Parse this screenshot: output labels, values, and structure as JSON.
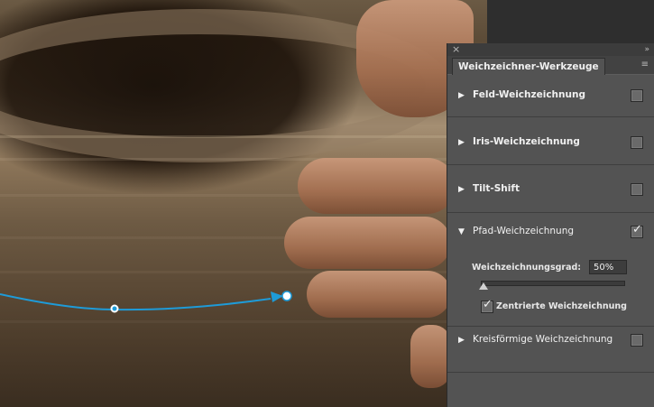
{
  "panel": {
    "close_glyph": "×",
    "collapse_glyph": "»",
    "menu_glyph": "≡",
    "tab_label": "Weichzeichner-Werkzeuge"
  },
  "sections": [
    {
      "label": "Feld-Weichzeichnung",
      "expanded": false,
      "checked": false
    },
    {
      "label": "Iris-Weichzeichnung",
      "expanded": false,
      "checked": false
    },
    {
      "label": "Tilt-Shift",
      "expanded": false,
      "checked": false
    },
    {
      "label": "Pfad-Weichzeichnung",
      "expanded": true,
      "checked": true
    },
    {
      "label": "Kreisförmige Weichzeichnung",
      "expanded": false,
      "checked": false
    }
  ],
  "path_blur": {
    "amount_label": "Weichzeichnungsgrad:",
    "amount_value": "50%",
    "amount_fraction": 0.0,
    "centered_label": "Zentrierte Weichzeichnung",
    "centered_checked": true
  },
  "glyphs": {
    "collapsed": "▶",
    "expanded": "▼",
    "tick": "✓"
  },
  "colors": {
    "panel_bg": "#535353",
    "path_line": "#1e9bd8",
    "handle": "#ffffff"
  }
}
